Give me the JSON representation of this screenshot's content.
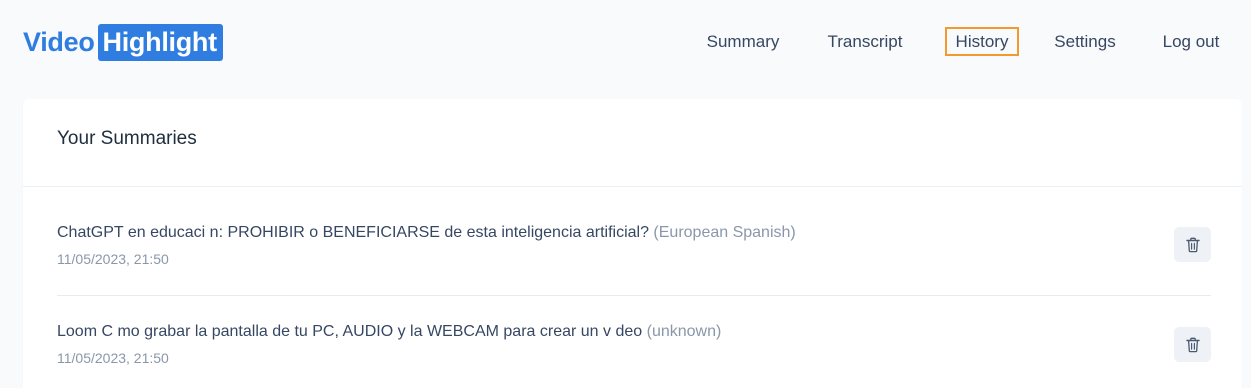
{
  "logo": {
    "part1": "Video",
    "part2": "Highlight"
  },
  "nav": {
    "items": [
      {
        "label": "Summary"
      },
      {
        "label": "Transcript"
      },
      {
        "label": "History",
        "active": true
      },
      {
        "label": "Settings"
      },
      {
        "label": "Log out"
      }
    ]
  },
  "colors": {
    "brand": "#2f7de1",
    "active_outline": "#f29a2e"
  },
  "summaries": {
    "title": "Your Summaries",
    "items": [
      {
        "title": "ChatGPT en educaci n: PROHIBIR o BENEFICIARSE de esta inteligencia artificial?",
        "language": "(European Spanish)",
        "date": "11/05/2023, 21:50",
        "action_icon": "trash-icon"
      },
      {
        "title": "Loom C mo grabar la pantalla de tu PC, AUDIO y la WEBCAM para crear un v deo",
        "language": "(unknown)",
        "date": "11/05/2023, 21:50",
        "action_icon": "trash-icon"
      }
    ]
  }
}
